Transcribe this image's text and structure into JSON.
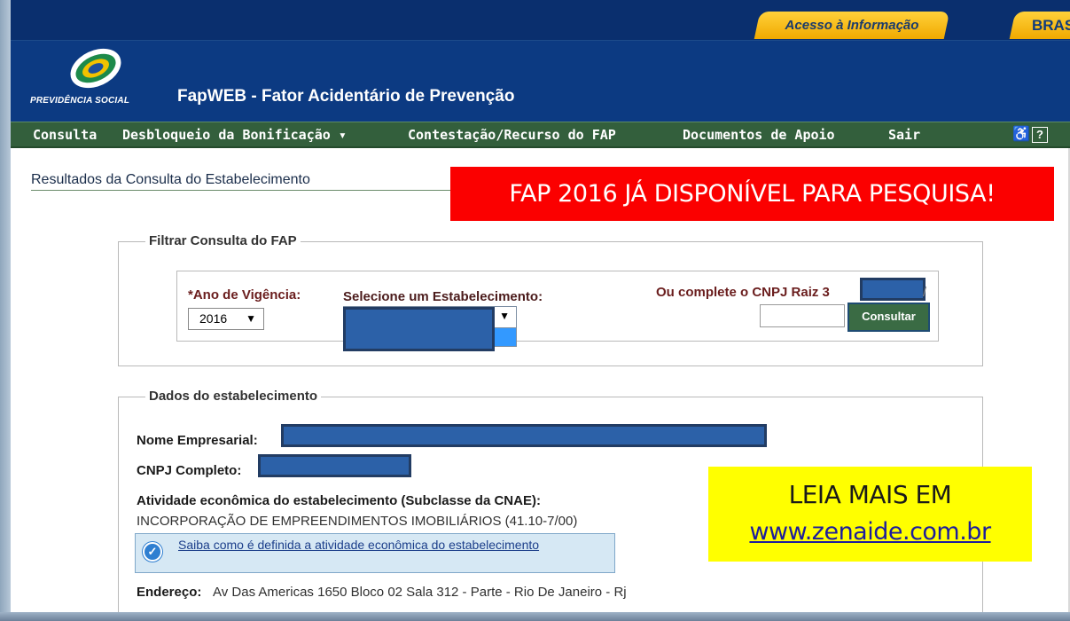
{
  "topbar": {
    "acesso_label": "Acesso à Informação",
    "brasil_label": "BRASIL"
  },
  "header": {
    "logo_text": "PREVIDÊNCIA SOCIAL",
    "app_title": "FapWEB - Fator Acidentário de Prevenção"
  },
  "nav": {
    "items": [
      "Consulta",
      "Desbloqueio da Bonificação ▾",
      "Contestação/Recurso do FAP",
      "Documentos de Apoio",
      "Sair"
    ],
    "accessibility_icon": "accessibility-icon",
    "help_icon": "?"
  },
  "page": {
    "title": "Resultados da Consulta do Estabelecimento"
  },
  "banner": {
    "text": "FAP 2016 JÁ DISPONÍVEL PARA PESQUISA!",
    "color": "#fb0000"
  },
  "filter": {
    "legend": "Filtrar Consulta do FAP",
    "year_label": "*Ano de Vigência:",
    "year_value": "2016",
    "estab_label": "Selecione um Estabelecimento:",
    "cnpj_label": "Ou complete o CNPJ Raiz 3",
    "cnpj_suffix": "/",
    "consult_button": "Consultar"
  },
  "dados": {
    "legend": "Dados do estabelecimento",
    "nome_label": "Nome Empresarial:",
    "cnpj_label": "CNPJ Completo:",
    "atividade_label": "Atividade econômica do estabelecimento (Subclasse da CNAE):",
    "atividade_value": "INCORPORAÇÃO DE EMPREENDIMENTOS IMOBILIÁRIOS (41.10-7/00)",
    "info_link": "Saiba como é definida a atividade econômica do estabelecimento",
    "endereco_label": "Endereço:",
    "endereco_value": "Av Das Americas 1650 Bloco 02 Sala 312 - Parte - Rio De Janeiro - Rj"
  },
  "promo": {
    "line1": "LEIA MAIS EM",
    "line2": "www.zenaide.com.br"
  }
}
